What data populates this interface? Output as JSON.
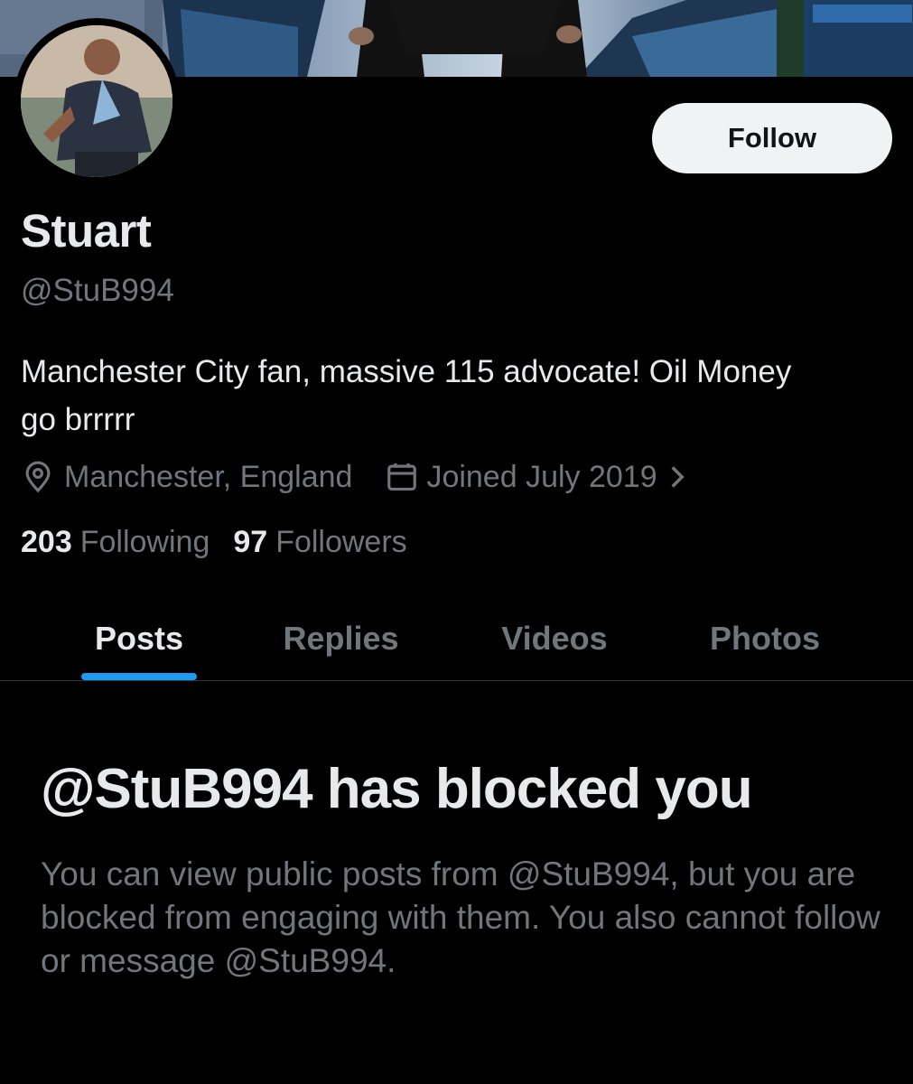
{
  "profile": {
    "display_name": "Stuart",
    "handle": "@StuB994",
    "bio": "Manchester City fan, massive 115 advocate! Oil Money go brrrrr",
    "location": "Manchester, England",
    "joined": "Joined July 2019",
    "following_count": "203",
    "following_label": "Following",
    "followers_count": "97",
    "followers_label": "Followers"
  },
  "actions": {
    "follow_label": "Follow"
  },
  "tabs": [
    {
      "label": "Posts",
      "active": true
    },
    {
      "label": "Replies",
      "active": false
    },
    {
      "label": "Videos",
      "active": false
    },
    {
      "label": "Photos",
      "active": false
    }
  ],
  "blocked_notice": {
    "title": "@StuB994 has blocked you",
    "body": "You can view public posts from @StuB994, but you are blocked from engaging with them. You also cannot follow or message @StuB994."
  },
  "icons": {
    "location": "location-pin-icon",
    "joined": "calendar-icon",
    "joined_more": "chevron-right-icon"
  },
  "colors": {
    "background": "#000000",
    "primary_text": "#e7e9ea",
    "secondary_text": "#71767b",
    "accent": "#1d9bf0",
    "follow_button_bg": "#eff3f4",
    "divider": "#2f3336"
  }
}
